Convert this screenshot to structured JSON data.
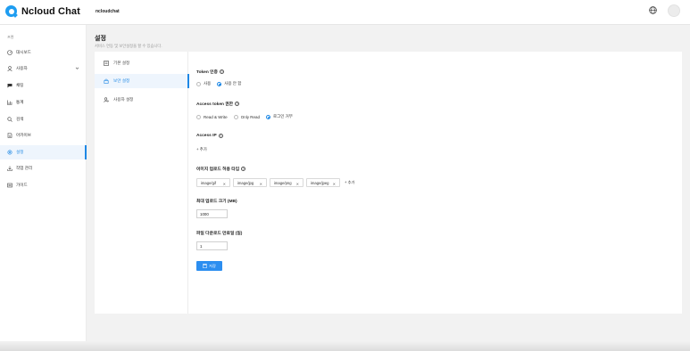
{
  "header": {
    "logo_text": "Ncloud Chat",
    "project_name": "ncloudchat"
  },
  "sidebar": {
    "section_label": "프렌",
    "items": [
      {
        "label": "대시보드",
        "icon": "dashboard-icon"
      },
      {
        "label": "사용자",
        "icon": "user-icon"
      },
      {
        "label": "채팅",
        "icon": "chat-icon"
      },
      {
        "label": "통계",
        "icon": "stats-icon"
      },
      {
        "label": "검색",
        "icon": "search-icon"
      },
      {
        "label": "아카이브",
        "icon": "archive-icon"
      },
      {
        "label": "설정",
        "icon": "settings-icon"
      },
      {
        "label": "작업 관리",
        "icon": "download-icon"
      },
      {
        "label": "가이드",
        "icon": "guide-icon"
      }
    ]
  },
  "page": {
    "title": "설정",
    "description": "서비스 연동 및 보안설정을 할 수 있습니다."
  },
  "settings_nav": {
    "items": [
      {
        "label": "기본 설정",
        "icon": "basic-settings-icon"
      },
      {
        "label": "보안 설정",
        "icon": "security-icon"
      },
      {
        "label": "사용자 설정",
        "icon": "user-settings-icon"
      }
    ]
  },
  "form": {
    "token_auth": {
      "label": "Token 인증",
      "options": [
        "사용",
        "사용 안 함"
      ],
      "selected": "사용 안 함"
    },
    "access_token_permission": {
      "label": "Access token 권한",
      "options": [
        "Read & Write",
        "Only Read",
        "로그인 거부"
      ],
      "selected": "로그인 거부"
    },
    "access_ip": {
      "label": "Access IP",
      "add_label": "+ 추가"
    },
    "image_upload_types": {
      "label": "이미지 업로드 허용 타입",
      "chips": [
        "image/gif",
        "image/jpg",
        "image/png",
        "image/jpeg"
      ],
      "add_label": "+ 추가"
    },
    "max_upload_size": {
      "label": "최대 업로드 크기 (MB)",
      "value": "1000"
    },
    "file_download_expiry": {
      "label": "파일 다운로드 만료일 (일)",
      "value": "1"
    },
    "save_label": "저장"
  },
  "colors": {
    "accent": "#1e88e5",
    "button": "#2c8ef0",
    "logo": "#1e9df1",
    "background": "#f2f2f2"
  }
}
